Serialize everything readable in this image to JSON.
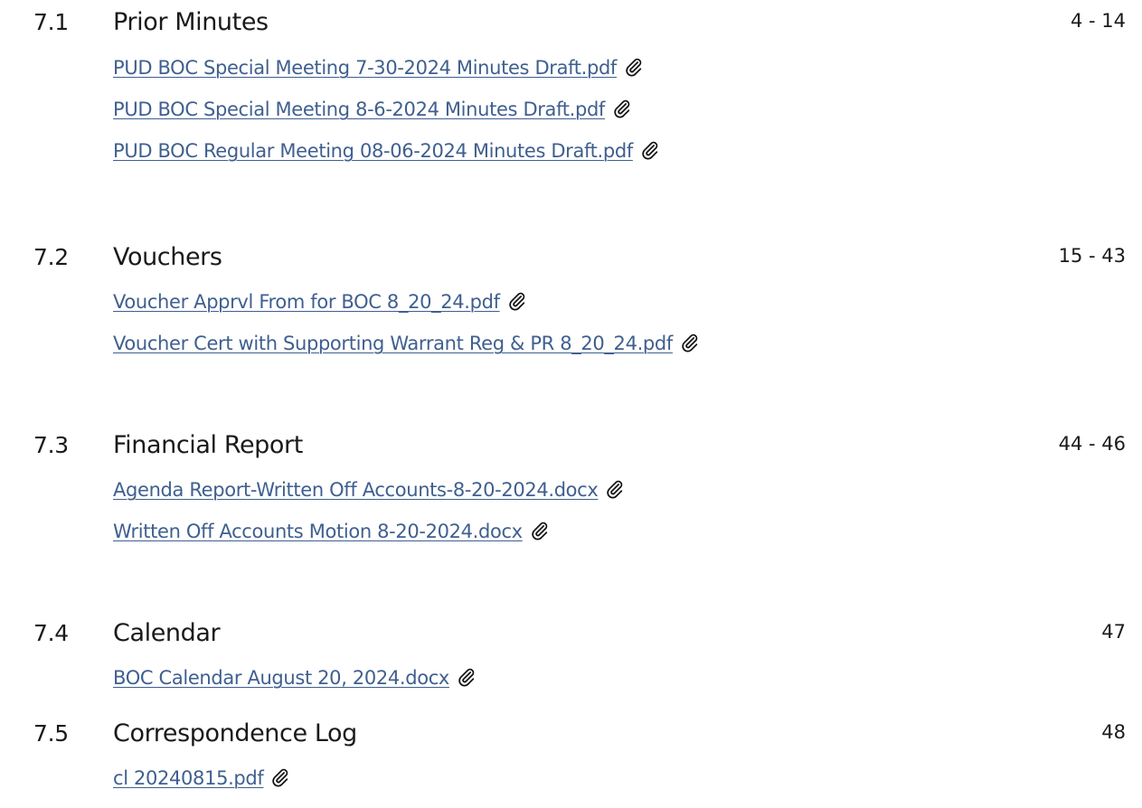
{
  "items": [
    {
      "number": "7.1",
      "title": "Prior Minutes",
      "pages": "4 - 14",
      "attachments": [
        {
          "label": "PUD BOC Special Meeting 7-30-2024 Minutes Draft.pdf",
          "icon": "paperclip-icon"
        },
        {
          "label": "PUD BOC Special Meeting 8-6-2024 Minutes Draft.pdf",
          "icon": "paperclip-icon"
        },
        {
          "label": "PUD BOC Regular Meeting 08-06-2024 Minutes Draft.pdf",
          "icon": "paperclip-icon"
        }
      ]
    },
    {
      "number": "7.2",
      "title": "Vouchers",
      "pages": "15 - 43",
      "attachments": [
        {
          "label": "Voucher Apprvl From for BOC 8_20_24.pdf",
          "icon": "paperclip-icon"
        },
        {
          "label": "Voucher Cert with Supporting Warrant Reg & PR 8_20_24.pdf",
          "icon": "paperclip-icon"
        }
      ]
    },
    {
      "number": "7.3",
      "title": "Financial Report",
      "pages": "44 - 46",
      "attachments": [
        {
          "label": "Agenda Report-Written Off Accounts-8-20-2024.docx",
          "icon": "paperclip-icon"
        },
        {
          "label": "Written Off Accounts Motion 8-20-2024.docx",
          "icon": "paperclip-icon"
        }
      ]
    },
    {
      "number": "7.4",
      "title": "Calendar",
      "pages": "47",
      "attachments": [
        {
          "label": "BOC Calendar August 20, 2024.docx",
          "icon": "paperclip-icon"
        }
      ]
    },
    {
      "number": "7.5",
      "title": "Correspondence Log",
      "pages": "48",
      "attachments": [
        {
          "label": "cl 20240815.pdf",
          "icon": "paperclip-icon"
        }
      ]
    }
  ],
  "colors": {
    "link": "#3f5f8f",
    "text": "#1a1a1a"
  }
}
